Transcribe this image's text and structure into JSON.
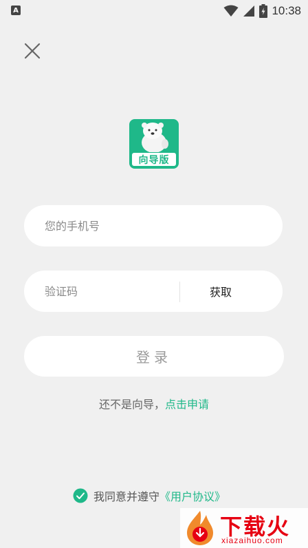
{
  "status_bar": {
    "left_icon": "A",
    "time": "10:38",
    "icons": [
      "wifi-icon",
      "signal-icon",
      "battery-charging-icon"
    ]
  },
  "close_icon": "close-icon",
  "logo": {
    "label": "向导版",
    "color": "#1fb889"
  },
  "phone_field": {
    "placeholder": "您的手机号"
  },
  "code_field": {
    "placeholder": "验证码",
    "get_code_label": "获取"
  },
  "login_button": {
    "label": "登录"
  },
  "apply": {
    "prefix": "还不是向导，",
    "link": "点击申请"
  },
  "agreement": {
    "prefix": "我同意并遵守",
    "link": "《用户协议》",
    "checked": true
  },
  "watermark": {
    "title": "下载火",
    "subtitle": "xiazaihuo.com"
  },
  "colors": {
    "accent": "#1fb889",
    "background": "#f0f0f0"
  }
}
